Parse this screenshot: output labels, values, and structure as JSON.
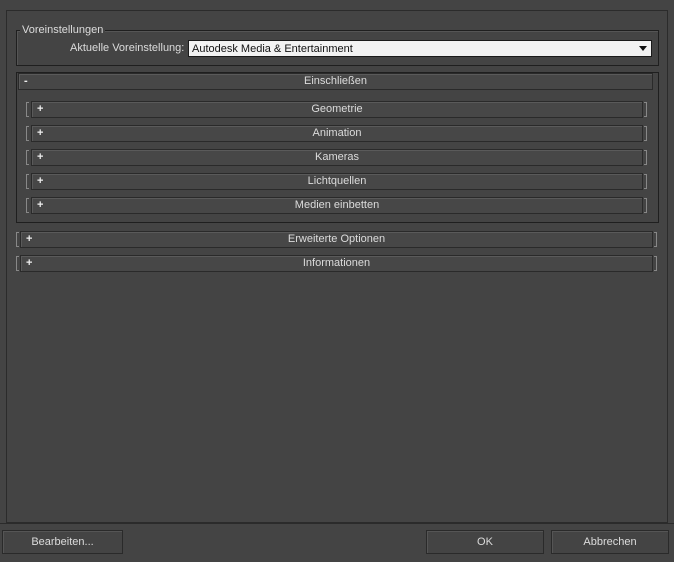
{
  "presets": {
    "legend": "Voreinstellungen",
    "label": "Aktuelle Voreinstellung:",
    "value": "Autodesk Media & Entertainment"
  },
  "include": {
    "sign": "-",
    "title": "Einschließen",
    "items": [
      {
        "sign": "+",
        "label": "Geometrie"
      },
      {
        "sign": "+",
        "label": "Animation"
      },
      {
        "sign": "+",
        "label": "Kameras"
      },
      {
        "sign": "+",
        "label": "Lichtquellen"
      },
      {
        "sign": "+",
        "label": "Medien einbetten"
      }
    ]
  },
  "advanced": {
    "sign": "+",
    "label": "Erweiterte Optionen"
  },
  "info": {
    "sign": "+",
    "label": "Informationen"
  },
  "buttons": {
    "edit": "Bearbeiten...",
    "ok": "OK",
    "cancel": "Abbrechen"
  }
}
